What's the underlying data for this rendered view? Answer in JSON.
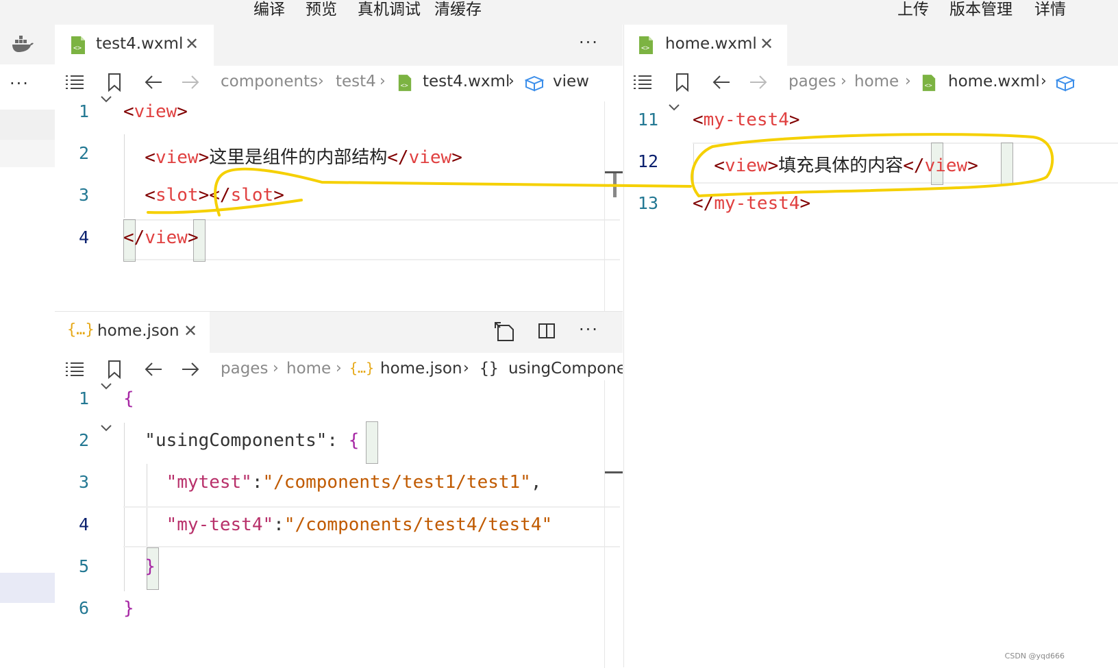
{
  "topbar": {
    "menus": [
      "编译",
      "预览",
      "真机调试",
      "清缓存"
    ],
    "right_menus": [
      "上传",
      "版本管理",
      "详情"
    ]
  },
  "activity": {
    "more_label": "···"
  },
  "left_top": {
    "tab": {
      "label": "test4.wxml",
      "close": "✕"
    },
    "more": "···",
    "breadcrumb": [
      "components",
      "test4",
      "test4.wxml",
      "view"
    ],
    "lines": [
      {
        "num": "1",
        "parts": [
          {
            "t": "<",
            "c": "#800000"
          },
          {
            "t": "view",
            "c": "#e04040"
          },
          {
            "t": ">",
            "c": "#800000"
          }
        ]
      },
      {
        "num": "2",
        "parts": [
          {
            "t": "  <",
            "c": "#800000"
          },
          {
            "t": "view",
            "c": "#e04040"
          },
          {
            "t": ">",
            "c": "#800000"
          },
          {
            "t": "这里是组件的内部结构",
            "c": "#222",
            "cn": true
          },
          {
            "t": "</",
            "c": "#800000"
          },
          {
            "t": "view",
            "c": "#e04040"
          },
          {
            "t": ">",
            "c": "#800000"
          }
        ]
      },
      {
        "num": "3",
        "parts": [
          {
            "t": "  <",
            "c": "#800000"
          },
          {
            "t": "slot",
            "c": "#e04040"
          },
          {
            "t": "></",
            "c": "#800000"
          },
          {
            "t": "slot",
            "c": "#e04040"
          },
          {
            "t": ">",
            "c": "#800000"
          }
        ]
      },
      {
        "num": "4",
        "parts": [
          {
            "t": "</",
            "c": "#800000"
          },
          {
            "t": "view",
            "c": "#e04040"
          },
          {
            "t": ">",
            "c": "#800000"
          }
        ]
      }
    ]
  },
  "left_bottom": {
    "tab": {
      "label": "home.json",
      "icon_text": "{…}",
      "close": "✕"
    },
    "more": "···",
    "breadcrumb": [
      "pages",
      "home",
      "home.json",
      "usingCompone"
    ],
    "crumb_icon_text": "{…}",
    "crumb_obj_icon_text": "{}",
    "lines": [
      {
        "num": "1",
        "parts": [
          {
            "t": "{",
            "c": "#a626a4"
          }
        ]
      },
      {
        "num": "2",
        "parts": [
          {
            "t": "  \"usingComponents\"",
            "c": "#333"
          },
          {
            "t": ": ",
            "c": "#333"
          },
          {
            "t": "{",
            "c": "#a626a4"
          }
        ]
      },
      {
        "num": "3",
        "parts": [
          {
            "t": "    \"mytest\"",
            "c": "#b8306a"
          },
          {
            "t": ":",
            "c": "#333"
          },
          {
            "t": "\"/components/test1/test1\"",
            "c": "#c05a00"
          },
          {
            "t": ",",
            "c": "#333"
          }
        ]
      },
      {
        "num": "4",
        "parts": [
          {
            "t": "    \"my-test4\"",
            "c": "#b8306a"
          },
          {
            "t": ":",
            "c": "#333"
          },
          {
            "t": "\"/components/test4/test4\"",
            "c": "#c05a00"
          }
        ]
      },
      {
        "num": "5",
        "parts": [
          {
            "t": "  }",
            "c": "#a626a4"
          }
        ]
      },
      {
        "num": "6",
        "parts": [
          {
            "t": "}",
            "c": "#a626a4"
          }
        ]
      }
    ]
  },
  "right": {
    "tab": {
      "label": "home.wxml",
      "close": "✕"
    },
    "breadcrumb": [
      "pages",
      "home",
      "home.wxml"
    ],
    "lines": [
      {
        "num": "11",
        "parts": [
          {
            "t": "<",
            "c": "#800000"
          },
          {
            "t": "my-test4",
            "c": "#e04040"
          },
          {
            "t": ">",
            "c": "#800000"
          }
        ]
      },
      {
        "num": "12",
        "parts": [
          {
            "t": "  <",
            "c": "#800000"
          },
          {
            "t": "view",
            "c": "#e04040"
          },
          {
            "t": ">",
            "c": "#800000"
          },
          {
            "t": "填充具体的内容",
            "c": "#222",
            "cn": true
          },
          {
            "t": "</",
            "c": "#800000"
          },
          {
            "t": "view",
            "c": "#e04040"
          },
          {
            "t": ">",
            "c": "#800000"
          }
        ]
      },
      {
        "num": "13",
        "parts": [
          {
            "t": "</",
            "c": "#800000"
          },
          {
            "t": "my-test4",
            "c": "#e04040"
          },
          {
            "t": ">",
            "c": "#800000"
          }
        ]
      }
    ]
  },
  "colors": {
    "tag_bracket": "#800000",
    "tag_name": "#e04040",
    "json_key": "#b8306a",
    "json_string": "#c05a00",
    "brace": "#a626a4",
    "line_number": "#237893",
    "annotation": "#f5d000",
    "file_icon_green": "#7cb342"
  },
  "icons": [
    "docker-icon",
    "list-icon",
    "bookmark-icon",
    "arrow-left-icon",
    "arrow-right-icon",
    "chevron-right-icon",
    "cube-icon",
    "wxml-file-icon",
    "json-file-icon",
    "close-icon",
    "more-icon",
    "open-changes-icon",
    "split-editor-icon",
    "fold-chevron-icon"
  ],
  "watermark": "CSDN @yqd666"
}
